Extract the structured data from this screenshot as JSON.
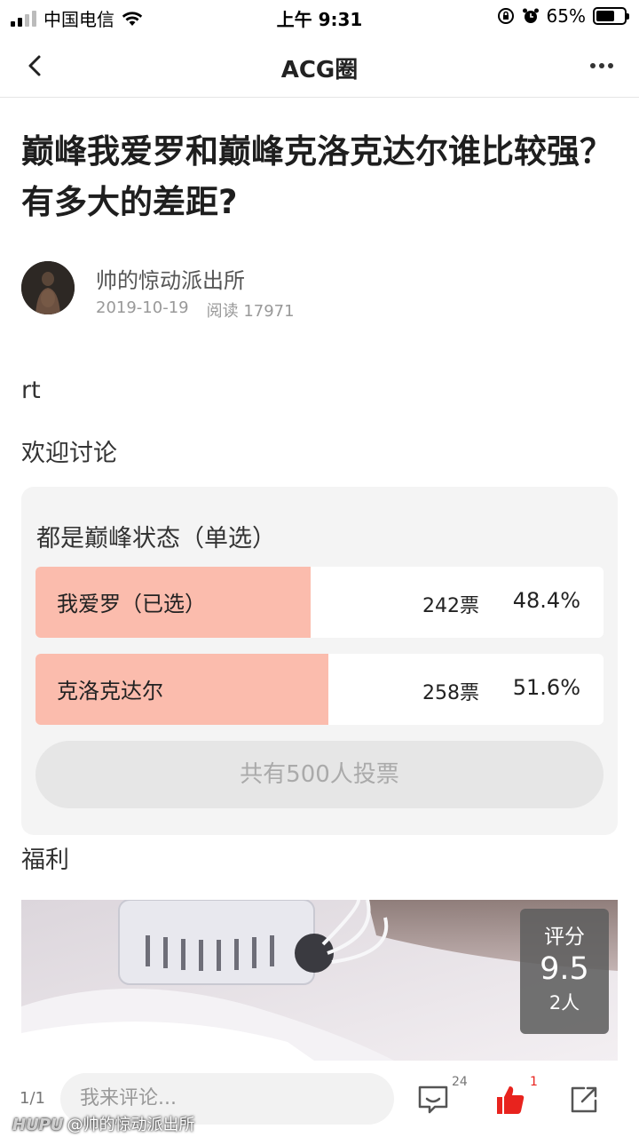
{
  "status_bar": {
    "carrier": "中国电信",
    "time": "上午 9:31",
    "battery": "65%",
    "battery_level": 0.65
  },
  "nav": {
    "title": "ACG圈",
    "back_icon": "chevron-left-icon",
    "more_icon": "more-dots-icon"
  },
  "post": {
    "title": "巅峰我爱罗和巅峰克洛克达尔谁比较强？有多大的差距?",
    "author": "帅的惊动派出所",
    "date": "2019-10-19",
    "views": "阅读 17971",
    "body": [
      "rt",
      "欢迎讨论"
    ]
  },
  "poll": {
    "question": "都是巅峰状态（单选）",
    "options": [
      {
        "label": "我爱罗（已选）",
        "votes": "242票",
        "percent": "48.4%",
        "fraction": 0.484,
        "selected": true
      },
      {
        "label": "克洛克达尔",
        "votes": "258票",
        "percent": "51.6%",
        "fraction": 0.516,
        "selected": false
      }
    ],
    "total": "共有500人投票",
    "bar_color": "#fbbcad"
  },
  "section_after_poll": "福利",
  "image_card": {
    "score_label": "评分",
    "score_value": "9.5",
    "score_count": "2人"
  },
  "bottom_bar": {
    "page_indicator": "1/1",
    "comment_placeholder": "我来评论...",
    "comment_count": "24",
    "like_count": "1",
    "like_color": "#e8231e"
  },
  "watermark": {
    "brand": "HUPU",
    "text": "@帅的惊动派出所"
  }
}
